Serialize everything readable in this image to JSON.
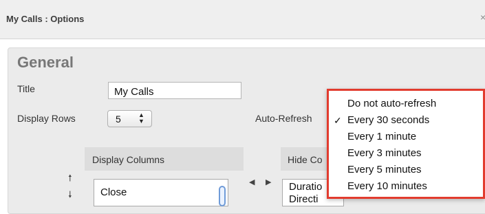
{
  "dialog": {
    "title": "My Calls : Options",
    "close_glyph": "×"
  },
  "general": {
    "heading": "General",
    "title_label": "Title",
    "title_value": "My Calls",
    "display_rows_label": "Display Rows",
    "display_rows_value": "5",
    "auto_refresh_label": "Auto-Refresh",
    "auto_refresh_selected": "Every 30 seconds",
    "auto_refresh_options": [
      "Do not auto-refresh",
      "Every 30 seconds",
      "Every 1 minute",
      "Every 3 minutes",
      "Every 5 minutes",
      "Every 10 minutes"
    ],
    "checkmark": "✓"
  },
  "columns": {
    "display_header": "Display Columns",
    "hide_header": "Hide Co",
    "display_items": [
      "Close"
    ],
    "hide_items": [
      "Duratio",
      "Directi"
    ]
  },
  "icons": {
    "up": "arrow-up-icon",
    "down": "arrow-down-icon",
    "left": "arrow-left-icon",
    "right": "arrow-right-icon",
    "select_arrows": "chevron-updown-icon"
  },
  "colors": {
    "highlight_border": "#e23b2e",
    "scrollbar": "#6f9bd8"
  }
}
